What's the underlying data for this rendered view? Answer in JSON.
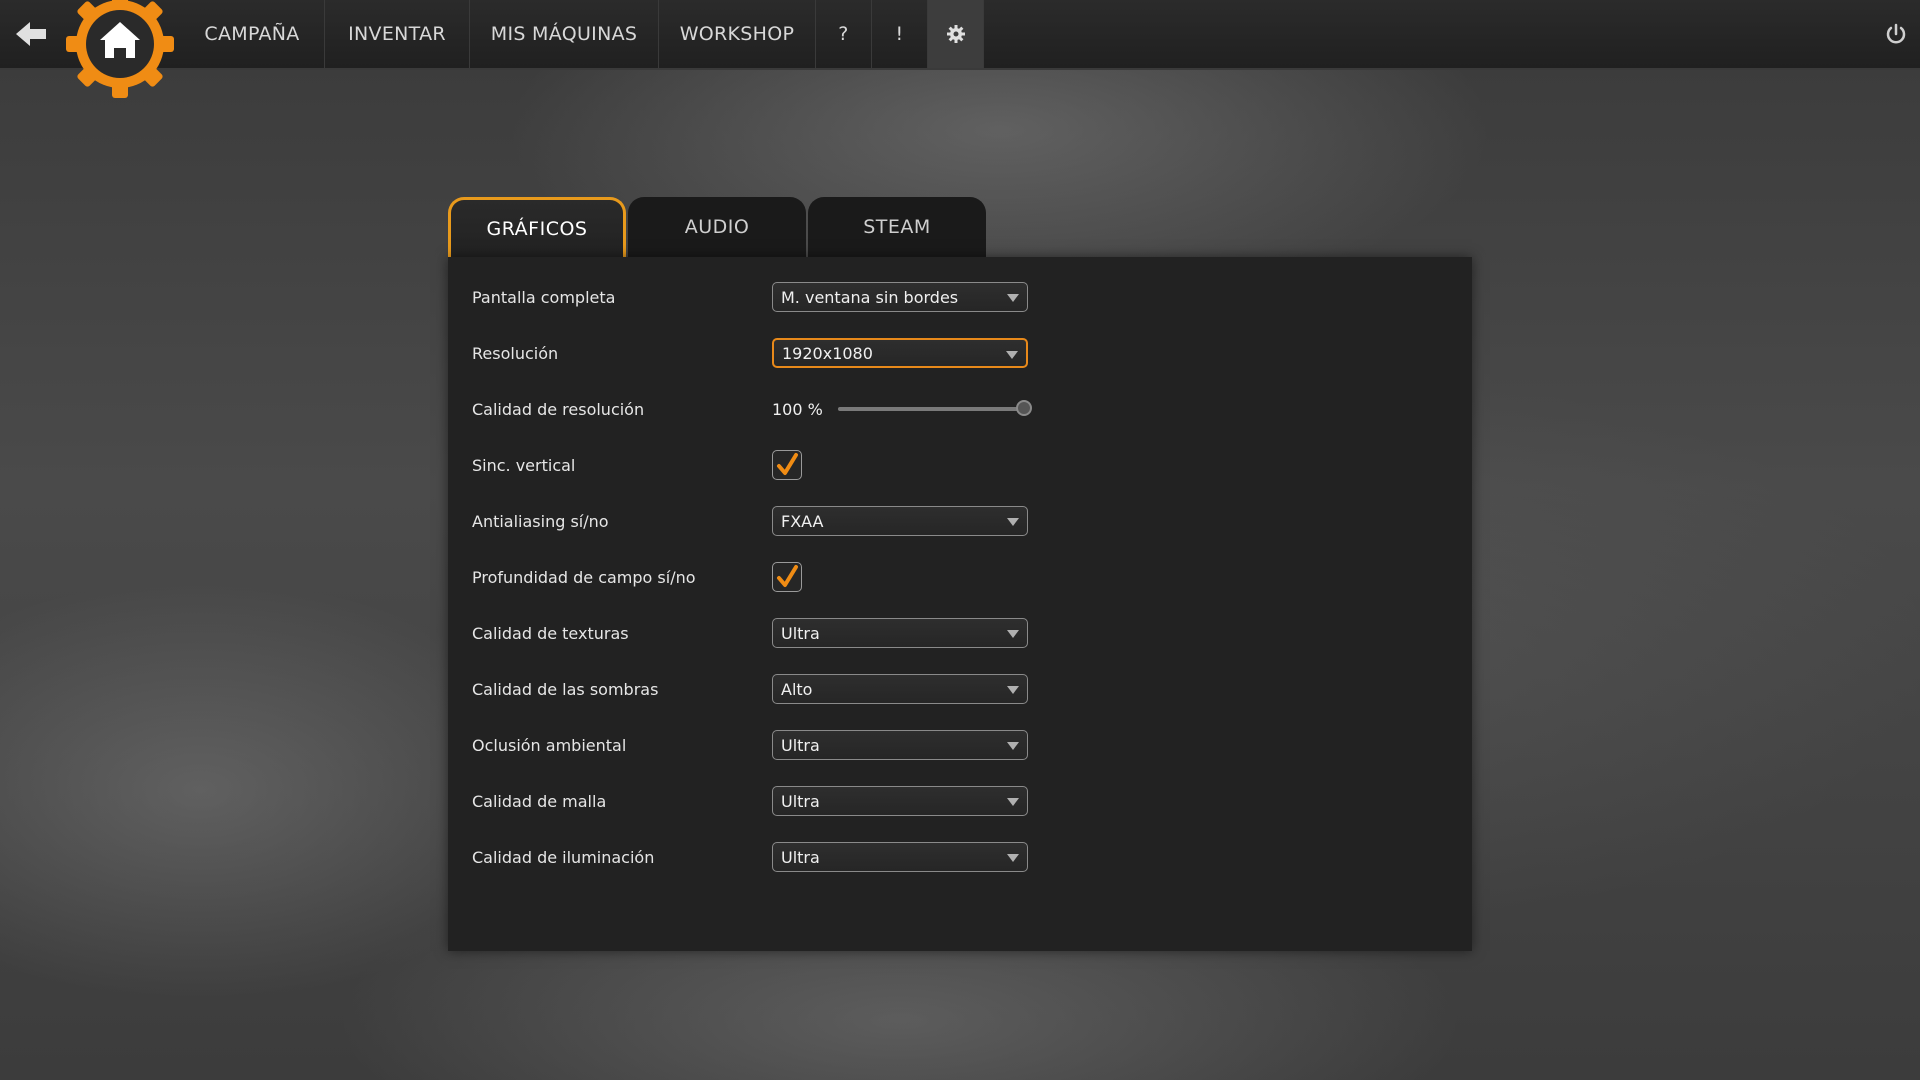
{
  "nav": {
    "back_icon": "arrow-left-icon",
    "logo_icon": "home-gear-icon",
    "items": [
      {
        "label": "CAMPAÑA",
        "active": false
      },
      {
        "label": "INVENTAR",
        "active": false
      },
      {
        "label": "MIS MÁQUINAS",
        "active": false
      },
      {
        "label": "WORKSHOP",
        "active": false
      },
      {
        "label": "?",
        "active": false
      },
      {
        "label": "!",
        "active": false
      },
      {
        "label": "gear-icon",
        "active": true
      }
    ],
    "power_icon": "power-icon"
  },
  "tabs": [
    {
      "label": "GRÁFICOS",
      "active": true
    },
    {
      "label": "AUDIO",
      "active": false
    },
    {
      "label": "STEAM",
      "active": false
    }
  ],
  "settings": {
    "fullscreen": {
      "label": "Pantalla completa",
      "value": "M. ventana sin bordes"
    },
    "resolution": {
      "label": "Resolución",
      "value": "1920x1080"
    },
    "resolution_quality": {
      "label": "Calidad de resolución",
      "value": "100 %",
      "level": 1.0
    },
    "vsync": {
      "label": "Sinc. vertical",
      "checked": true
    },
    "antialiasing": {
      "label": "Antialiasing sí/no",
      "value": "FXAA"
    },
    "depth_of_field": {
      "label": "Profundidad de campo sí/no",
      "checked": true
    },
    "texture_quality": {
      "label": "Calidad de texturas",
      "value": "Ultra"
    },
    "shadow_quality": {
      "label": "Calidad de las sombras",
      "value": "Alto"
    },
    "ambient_occlusion": {
      "label": "Oclusión ambiental",
      "value": "Ultra"
    },
    "mesh_quality": {
      "label": "Calidad de malla",
      "value": "Ultra"
    },
    "lighting_quality": {
      "label": "Calidad de iluminación",
      "value": "Ultra"
    }
  },
  "colors": {
    "accent": "#e8891a",
    "logo": "#f08c14",
    "panel_bg": "#222222"
  }
}
